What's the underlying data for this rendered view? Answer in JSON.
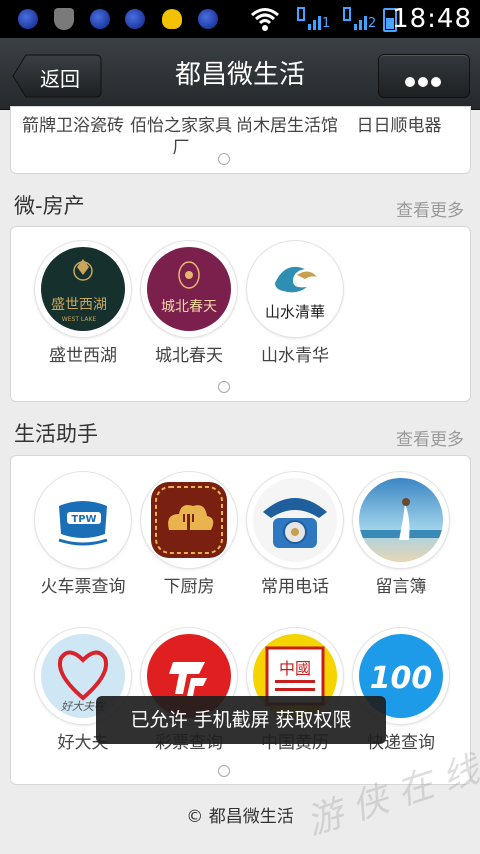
{
  "status_bar": {
    "time": "18:48",
    "signal_1": "1",
    "signal_2": "2",
    "battery_level": 0.55,
    "colors": {
      "accent": "#3ea4ff"
    },
    "icons": [
      "blue-dot-icon",
      "shield-icon",
      "blue-dot-icon",
      "blue-dot-icon",
      "qq-icon",
      "blue-dot-icon",
      "wifi-icon",
      "signal-icon",
      "battery-icon"
    ]
  },
  "header": {
    "back_label": "返回",
    "title": "都昌微生活",
    "more_icon": "more-dots-icon"
  },
  "brands": {
    "items": [
      {
        "label": "箭牌卫浴瓷砖"
      },
      {
        "label": "佰怡之家家具厂"
      },
      {
        "label": "尚木居生活馆"
      },
      {
        "label": "日日顺电器"
      }
    ]
  },
  "real_estate": {
    "title": "微-房产",
    "more_label": "查看更多",
    "items": [
      {
        "label": "盛世西湖",
        "logo_text": "盛世西湖",
        "logo_sub": "WEST LAKE",
        "icon": "shengshi-xihu-logo"
      },
      {
        "label": "城北春天",
        "logo_text": "城北春天",
        "icon": "chengbei-chuntian-logo"
      },
      {
        "label": "山水青华",
        "logo_text": "山水清華",
        "icon": "shanshui-qinghua-logo"
      }
    ]
  },
  "life": {
    "title": "生活助手",
    "more_label": "查看更多",
    "items": [
      {
        "label": "火车票查询",
        "logo_text": "TPW",
        "icon": "train-ticket-icon"
      },
      {
        "label": "下厨房",
        "icon": "cooking-icon"
      },
      {
        "label": "常用电话",
        "icon": "telephone-icon"
      },
      {
        "label": "留言簿",
        "icon": "guestbook-icon"
      },
      {
        "label": "好大夫",
        "logo_text": "好大夫在",
        "icon": "doctor-icon"
      },
      {
        "label": "彩票查询",
        "icon": "lottery-icon"
      },
      {
        "label": "中国黄历",
        "logo_text": "中國",
        "icon": "almanac-icon"
      },
      {
        "label": "快递查询",
        "logo_text": "100",
        "icon": "express-icon"
      }
    ]
  },
  "toast": "已允许 手机截屏 获取权限",
  "footer": "© 都昌微生活",
  "watermark": "游 侠 在 线 www.duchang"
}
